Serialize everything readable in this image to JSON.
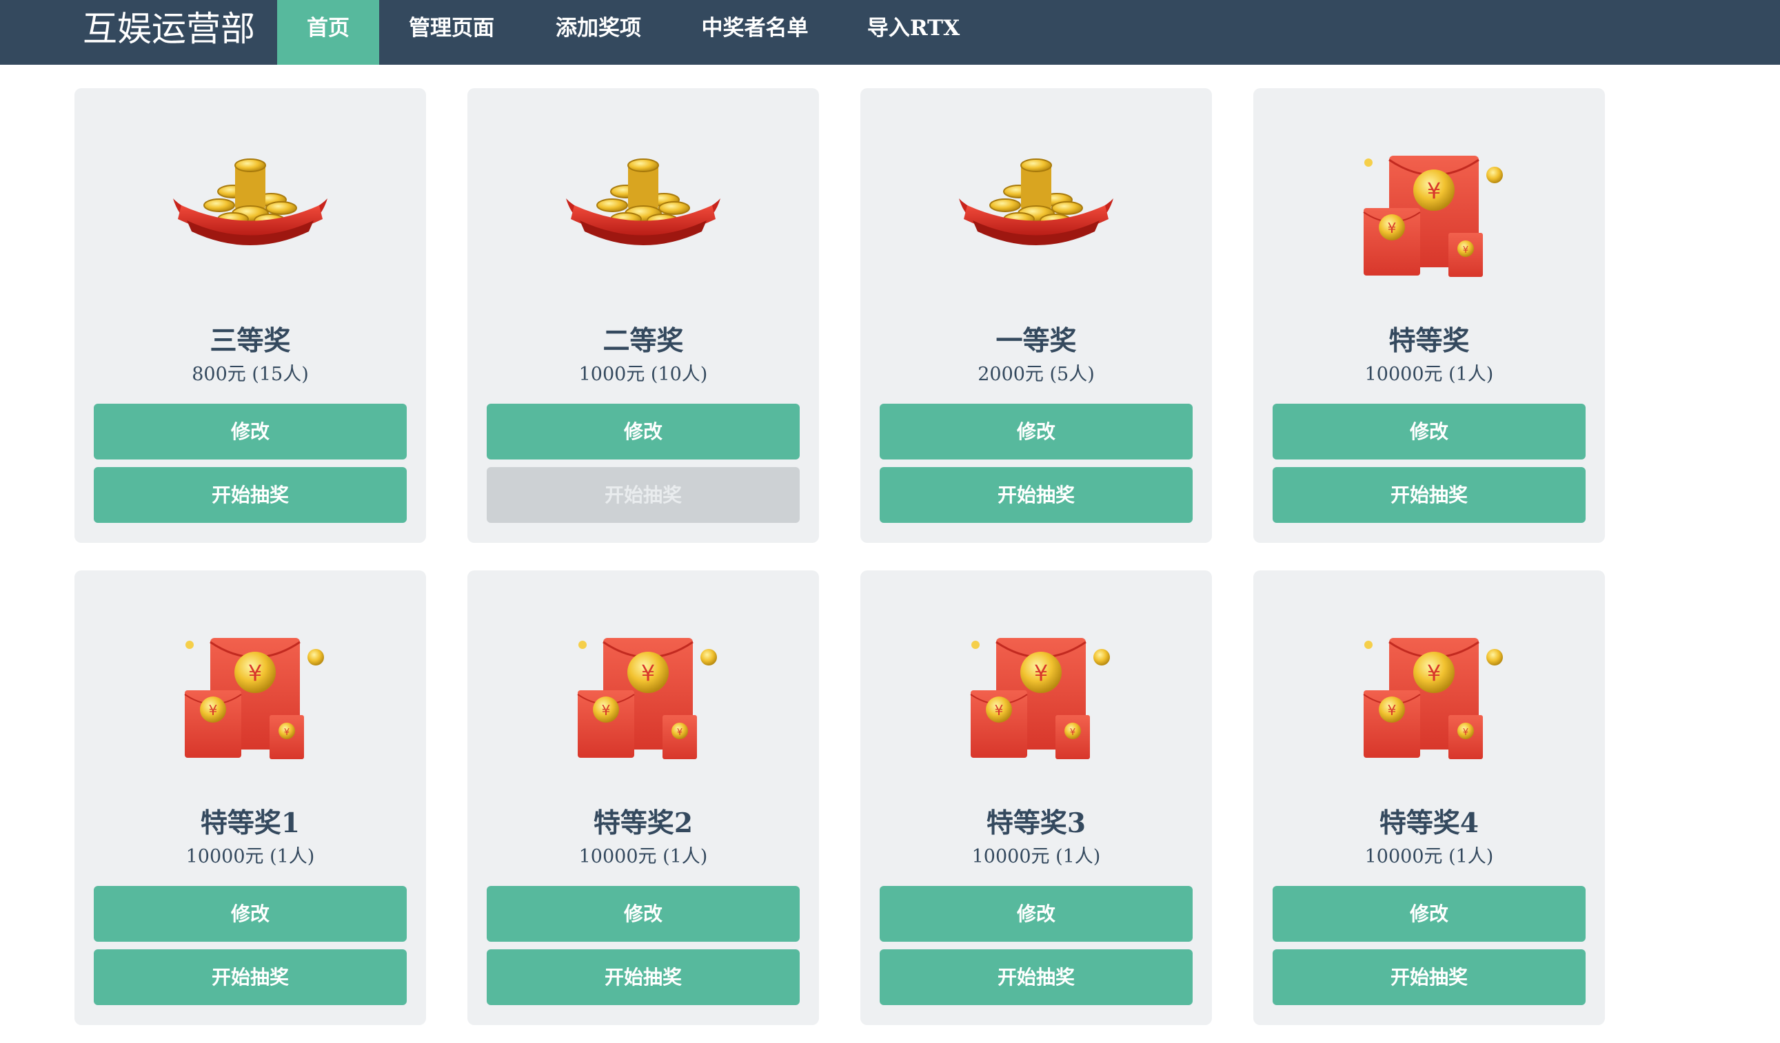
{
  "nav": {
    "brand": "互娱运营部",
    "items": [
      {
        "label": "首页",
        "active": true
      },
      {
        "label": "管理页面",
        "active": false
      },
      {
        "label": "添加奖项",
        "active": false
      },
      {
        "label": "中奖者名单",
        "active": false
      },
      {
        "label": "导入RTX",
        "active": false
      }
    ]
  },
  "colors": {
    "nav_bg": "#34495e",
    "accent": "#57b99d",
    "card_bg": "#eef0f2",
    "disabled_bg": "#cdd1d4",
    "text": "#34495e"
  },
  "prizes": [
    {
      "name": "三等奖",
      "desc": "800元 (15人)",
      "icon": "gold-coins-icon",
      "edit_label": "修改",
      "start_label": "开始抽奖",
      "start_disabled": false
    },
    {
      "name": "二等奖",
      "desc": "1000元 (10人)",
      "icon": "gold-coins-icon",
      "edit_label": "修改",
      "start_label": "开始抽奖",
      "start_disabled": true
    },
    {
      "name": "一等奖",
      "desc": "2000元 (5人)",
      "icon": "gold-coins-icon",
      "edit_label": "修改",
      "start_label": "开始抽奖",
      "start_disabled": false
    },
    {
      "name": "特等奖",
      "desc": "10000元 (1人)",
      "icon": "red-envelope-icon",
      "edit_label": "修改",
      "start_label": "开始抽奖",
      "start_disabled": false
    },
    {
      "name": "特等奖1",
      "desc": "10000元 (1人)",
      "icon": "red-envelope-icon",
      "edit_label": "修改",
      "start_label": "开始抽奖",
      "start_disabled": false
    },
    {
      "name": "特等奖2",
      "desc": "10000元 (1人)",
      "icon": "red-envelope-icon",
      "edit_label": "修改",
      "start_label": "开始抽奖",
      "start_disabled": false
    },
    {
      "name": "特等奖3",
      "desc": "10000元 (1人)",
      "icon": "red-envelope-icon",
      "edit_label": "修改",
      "start_label": "开始抽奖",
      "start_disabled": false
    },
    {
      "name": "特等奖4",
      "desc": "10000元 (1人)",
      "icon": "red-envelope-icon",
      "edit_label": "修改",
      "start_label": "开始抽奖",
      "start_disabled": false
    }
  ]
}
